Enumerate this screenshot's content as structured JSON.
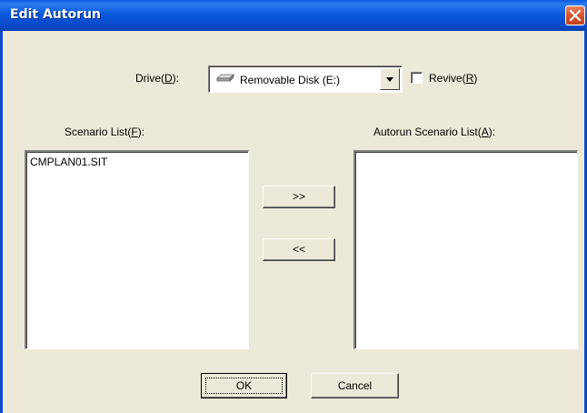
{
  "window": {
    "title": "Edit Autorun"
  },
  "drive": {
    "label_prefix": "Drive(",
    "label_key": "D",
    "label_suffix": "):",
    "selected": "Removable Disk (E:)",
    "icon": "removable-disk-icon"
  },
  "revive": {
    "label_prefix": "Revive(",
    "label_key": "R",
    "label_suffix": ")",
    "checked": false
  },
  "scenario_list": {
    "label_prefix": "Scenario List(",
    "label_key": "F",
    "label_suffix": "):",
    "items": [
      "CMPLAN01.SIT"
    ]
  },
  "autorun_list": {
    "label_prefix": "Autorun Scenario List(",
    "label_key": "A",
    "label_suffix": "):",
    "items": []
  },
  "buttons": {
    "add": ">>",
    "remove": "<<",
    "ok": "OK",
    "cancel": "Cancel"
  },
  "colors": {
    "titlebar": "#0a5ae0",
    "dialog_bg": "#ece9d8",
    "close_button": "#d8542c"
  }
}
